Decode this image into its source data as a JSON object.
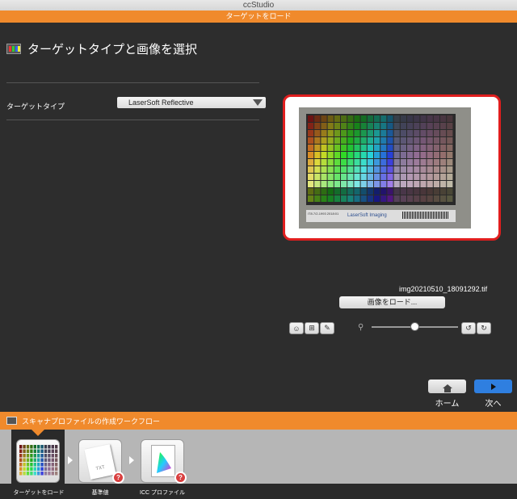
{
  "window": {
    "title": "ccStudio"
  },
  "step_bar": {
    "title": "ターゲットをロード"
  },
  "header": {
    "title": "ターゲットタイプと画像を選択"
  },
  "target_type": {
    "label": "ターゲットタイプ",
    "selected": "LaserSoft Reflective"
  },
  "preview": {
    "brand": "LaserSoft Imaging",
    "target_id": "IT8.7/2-1993 2018:01",
    "filename": "img20210510_18091292.tif"
  },
  "load_button": {
    "label": "画像をロード..."
  },
  "tools": {
    "icons": [
      "face-detect-icon",
      "crop-frame-icon",
      "eraser-icon"
    ],
    "zoom_icon": "zoom-icon",
    "rotate_icons": [
      "rotate-left-icon",
      "rotate-right-icon"
    ]
  },
  "zoom": {
    "level": 0.5
  },
  "nav": {
    "home_label": "ホーム",
    "next_label": "次へ"
  },
  "workflow": {
    "title": "スキャナプロファイルの作成ワークフロー",
    "steps": [
      {
        "label": "ターゲットをロード",
        "active": true
      },
      {
        "label": "基準値",
        "active": false,
        "badge": "?"
      },
      {
        "label": "ICC プロファイル",
        "active": false,
        "badge": "?"
      }
    ],
    "reference_icon_text": "TXT"
  },
  "colors": {
    "accent_orange": "#f08a2c",
    "highlight_red": "#e01e1e",
    "next_blue": "#2f7fe0"
  }
}
